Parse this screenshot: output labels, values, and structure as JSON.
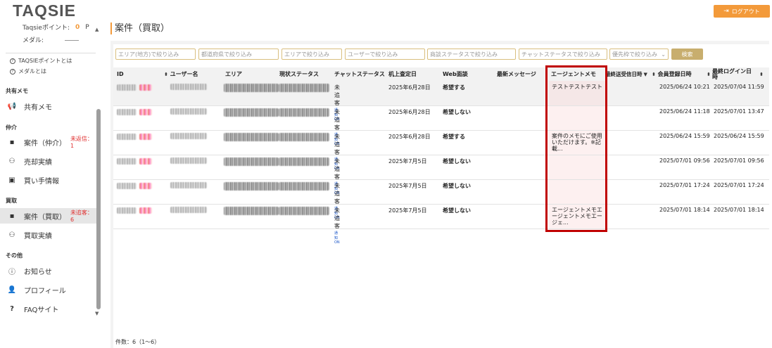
{
  "header": {
    "logo": "TAQSIE",
    "logout_label": "ログアウト"
  },
  "sidebar": {
    "points_label": "Taqsieポイント:",
    "points_value": "0",
    "points_unit": "P",
    "medal_label": "メダル:",
    "help_points": "TAQSIEポイントとは",
    "help_medal": "メダルとは",
    "sections": {
      "shared": "共有メモ",
      "broker": "仲介",
      "purchase": "買取",
      "other": "その他"
    },
    "items": {
      "shared_memo": "共有メモ",
      "case_broker": "案件（仲介）",
      "case_broker_badge": "未返信：1",
      "sales_record": "売却実績",
      "buyer_info": "買い手情報",
      "case_purchase": "案件（買取）",
      "case_purchase_badge": "未追客：6",
      "purchase_record": "買取実績",
      "notice": "お知らせ",
      "profile": "プロフィール",
      "faq": "FAQサイト"
    }
  },
  "page_title": "案件（買取）",
  "filters": {
    "area_local": "エリア(地方)で絞り込み",
    "prefecture": "都道府県で絞り込み",
    "area": "エリアで絞り込み",
    "user": "ユーザーで絞り込み",
    "deal_status": "商談ステータスで絞り込み",
    "chat_status": "チャットステータスで絞り込み",
    "priority": "優先枠で絞り込み",
    "search_label": "検索"
  },
  "table": {
    "headers": {
      "id": "ID",
      "user": "ユーザー名",
      "area": "エリア",
      "current_status": "現状ステータス",
      "chat_status": "チャットステータス",
      "desk_date": "机上査定日",
      "web": "Web面談",
      "latest_msg": "最新メッセージ",
      "agent_memo": "エージェントメモ",
      "last_sent": "最終送受信日時",
      "registered": "会員登録日時",
      "last_login": "最終ログイン日時"
    },
    "rows": [
      {
        "chat": "未追客",
        "notify": "通知ON",
        "desk": "2025年6月28日",
        "web": "希望する",
        "memo": "テストテストテスト",
        "registered": "2025/06/24 10:21",
        "login": "2025/07/04 11:59"
      },
      {
        "chat": "未追客",
        "notify": "通知ON",
        "desk": "2025年6月28日",
        "web": "希望しない",
        "memo": "",
        "registered": "2025/06/24 11:18",
        "login": "2025/07/01 13:47"
      },
      {
        "chat": "未追客",
        "notify": "通知ON",
        "desk": "2025年6月28日",
        "web": "希望する",
        "memo": "案件のメモにご使用いただけます。※記載...",
        "registered": "2025/06/24 15:59",
        "login": "2025/06/24 15:59"
      },
      {
        "chat": "未追客",
        "notify": "通知ON",
        "desk": "2025年7月5日",
        "web": "希望しない",
        "memo": "",
        "registered": "2025/07/01 09:56",
        "login": "2025/07/01 09:56"
      },
      {
        "chat": "未追客",
        "notify": "通知ON",
        "desk": "2025年7月5日",
        "web": "希望しない",
        "memo": "",
        "registered": "2025/07/01 17:24",
        "login": "2025/07/01 17:24"
      },
      {
        "chat": "未追客",
        "notify": "通知ON",
        "desk": "2025年7月5日",
        "web": "希望しない",
        "memo": "エージェントメモエージェントメモエージェ...",
        "registered": "2025/07/01 18:14",
        "login": "2025/07/01 18:14"
      }
    ]
  },
  "footer_count": "件数：6（1～6）",
  "colors": {
    "accent": "#f39a3a",
    "gold": "#c8ae6e",
    "highlight": "#c00000",
    "badge_red": "#e03030"
  }
}
